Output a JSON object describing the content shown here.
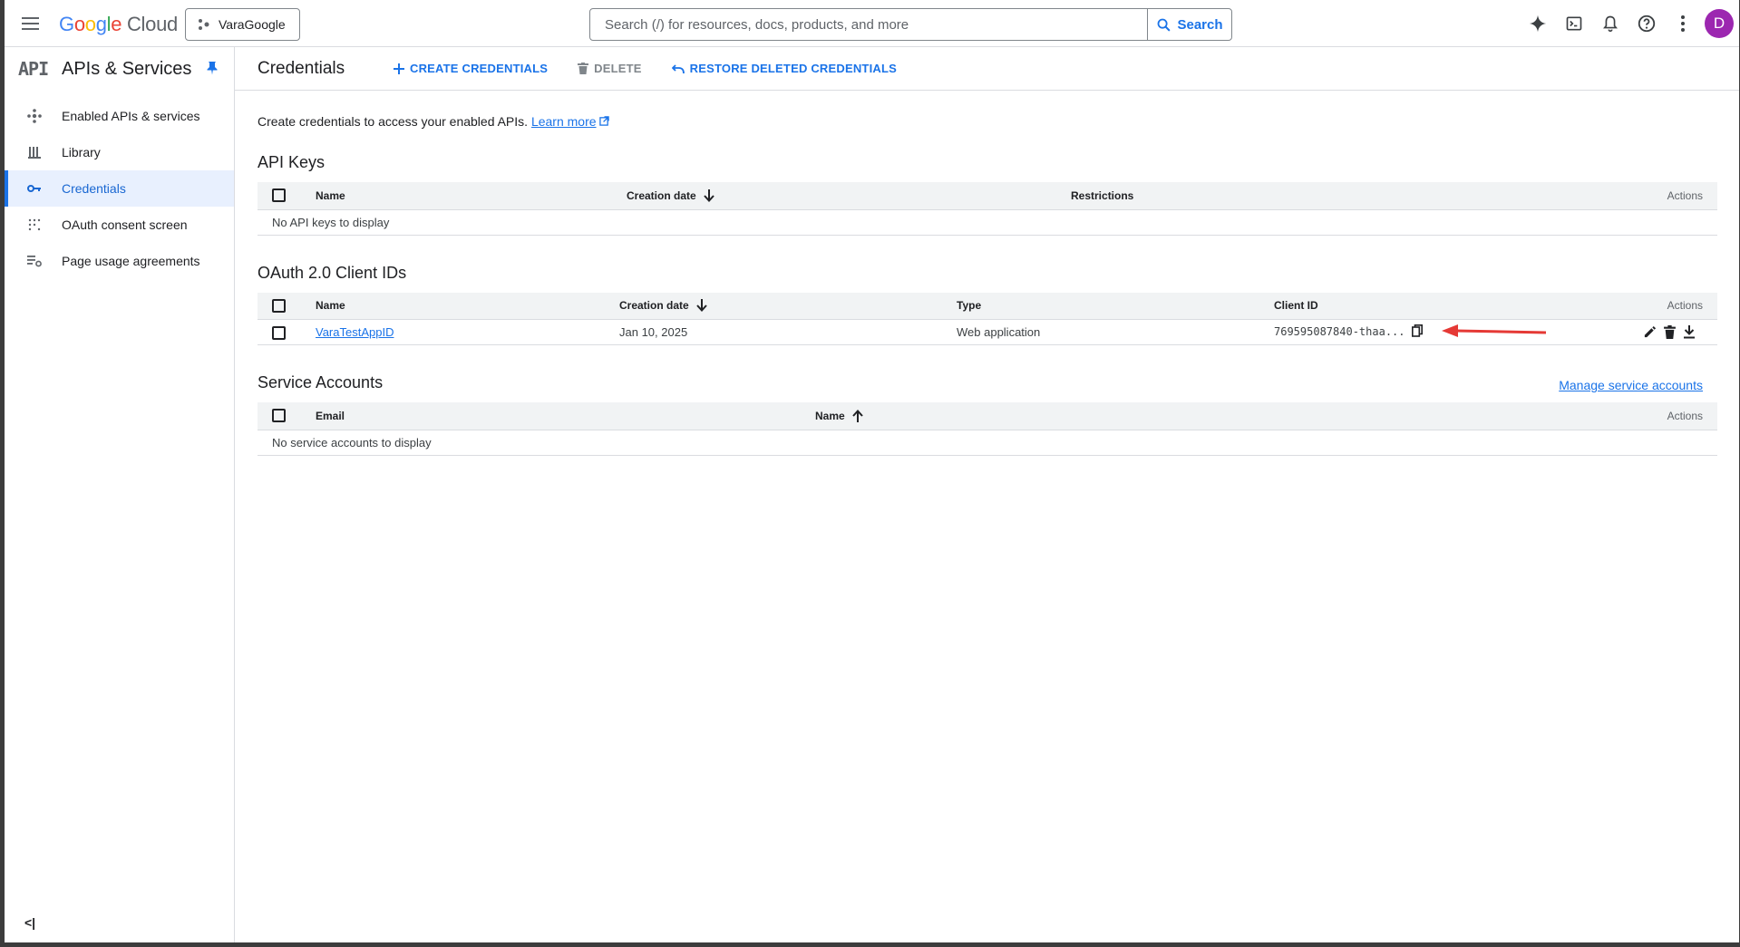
{
  "header": {
    "logo_google": "Google",
    "logo_cloud": "Cloud",
    "project": "VaraGoogle",
    "search_placeholder": "Search (/) for resources, docs, products, and more",
    "search_button": "Search",
    "avatar_letter": "D",
    "icons": [
      "gemini-icon",
      "cloud-shell-icon",
      "notifications-icon",
      "help-icon",
      "more-vert-icon"
    ]
  },
  "sidebar": {
    "badge": "API",
    "title": "APIs & Services",
    "items": [
      {
        "label": "Enabled APIs & services",
        "icon": "enabled-apis-icon"
      },
      {
        "label": "Library",
        "icon": "library-icon"
      },
      {
        "label": "Credentials",
        "icon": "key-icon",
        "active": true
      },
      {
        "label": "OAuth consent screen",
        "icon": "oauth-icon"
      },
      {
        "label": "Page usage agreements",
        "icon": "settings-list-icon"
      }
    ],
    "collapse_label": "<|"
  },
  "actionbar": {
    "title": "Credentials",
    "create": "CREATE CREDENTIALS",
    "delete": "DELETE",
    "restore": "RESTORE DELETED CREDENTIALS"
  },
  "intro": {
    "text": "Create credentials to access your enabled APIs.",
    "link": "Learn more"
  },
  "api_keys": {
    "title": "API Keys",
    "columns": {
      "name": "Name",
      "creation_date": "Creation date",
      "restrictions": "Restrictions",
      "actions": "Actions"
    },
    "empty": "No API keys to display"
  },
  "oauth": {
    "title": "OAuth 2.0 Client IDs",
    "columns": {
      "name": "Name",
      "creation_date": "Creation date",
      "type": "Type",
      "client_id": "Client ID",
      "actions": "Actions"
    },
    "rows": [
      {
        "name": "VaraTestAppID",
        "creation_date": "Jan 10, 2025",
        "type": "Web application",
        "client_id": "769595087840-thaa..."
      }
    ]
  },
  "service_accounts": {
    "title": "Service Accounts",
    "manage_link": "Manage service accounts",
    "columns": {
      "email": "Email",
      "name": "Name",
      "actions": "Actions"
    },
    "empty": "No service accounts to display"
  },
  "colors": {
    "accent": "#1a73e8",
    "active_bg": "#e8f0fe",
    "annotation_arrow": "#e53935"
  }
}
